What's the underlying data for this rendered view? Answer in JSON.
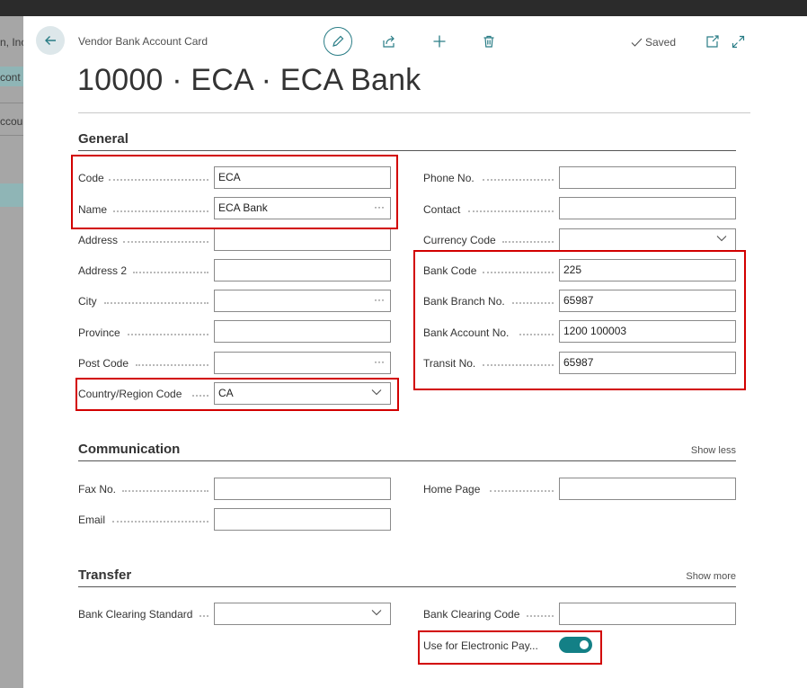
{
  "background": {
    "frag_line1": "n, Inc",
    "frag_line2": "cont",
    "frag_line3": "ccou"
  },
  "header": {
    "caption": "Vendor Bank Account Card",
    "title": "10000 · ECA · ECA Bank",
    "saved_label": "Saved"
  },
  "general": {
    "heading": "General",
    "left": [
      {
        "label": "Code",
        "value": "ECA"
      },
      {
        "label": "Name",
        "value": "ECA Bank"
      },
      {
        "label": "Address",
        "value": ""
      },
      {
        "label": "Address 2",
        "value": ""
      },
      {
        "label": "City",
        "value": ""
      },
      {
        "label": "Province",
        "value": ""
      },
      {
        "label": "Post Code",
        "value": ""
      },
      {
        "label": "Country/Region Code",
        "value": "CA"
      }
    ],
    "right": [
      {
        "label": "Phone No.",
        "value": ""
      },
      {
        "label": "Contact",
        "value": ""
      },
      {
        "label": "Currency Code",
        "value": ""
      },
      {
        "label": "Bank Code",
        "value": "225"
      },
      {
        "label": "Bank Branch No.",
        "value": "65987"
      },
      {
        "label": "Bank Account No.",
        "value": "1200 100003"
      },
      {
        "label": "Transit No.",
        "value": "65987"
      }
    ]
  },
  "communication": {
    "heading": "Communication",
    "show_link": "Show less",
    "fields": [
      {
        "label": "Fax No.",
        "value": ""
      },
      {
        "label": "Email",
        "value": ""
      },
      {
        "label": "Home Page",
        "value": ""
      }
    ]
  },
  "transfer": {
    "heading": "Transfer",
    "show_link": "Show more",
    "fields": [
      {
        "label": "Bank Clearing Standard",
        "value": ""
      },
      {
        "label": "Bank Clearing Code",
        "value": ""
      },
      {
        "label": "Use for Electronic Pay...",
        "value": "on"
      }
    ]
  },
  "colors": {
    "accent": "#138086",
    "highlight": "#d20000",
    "back_button_bg": "#dde7ea"
  }
}
